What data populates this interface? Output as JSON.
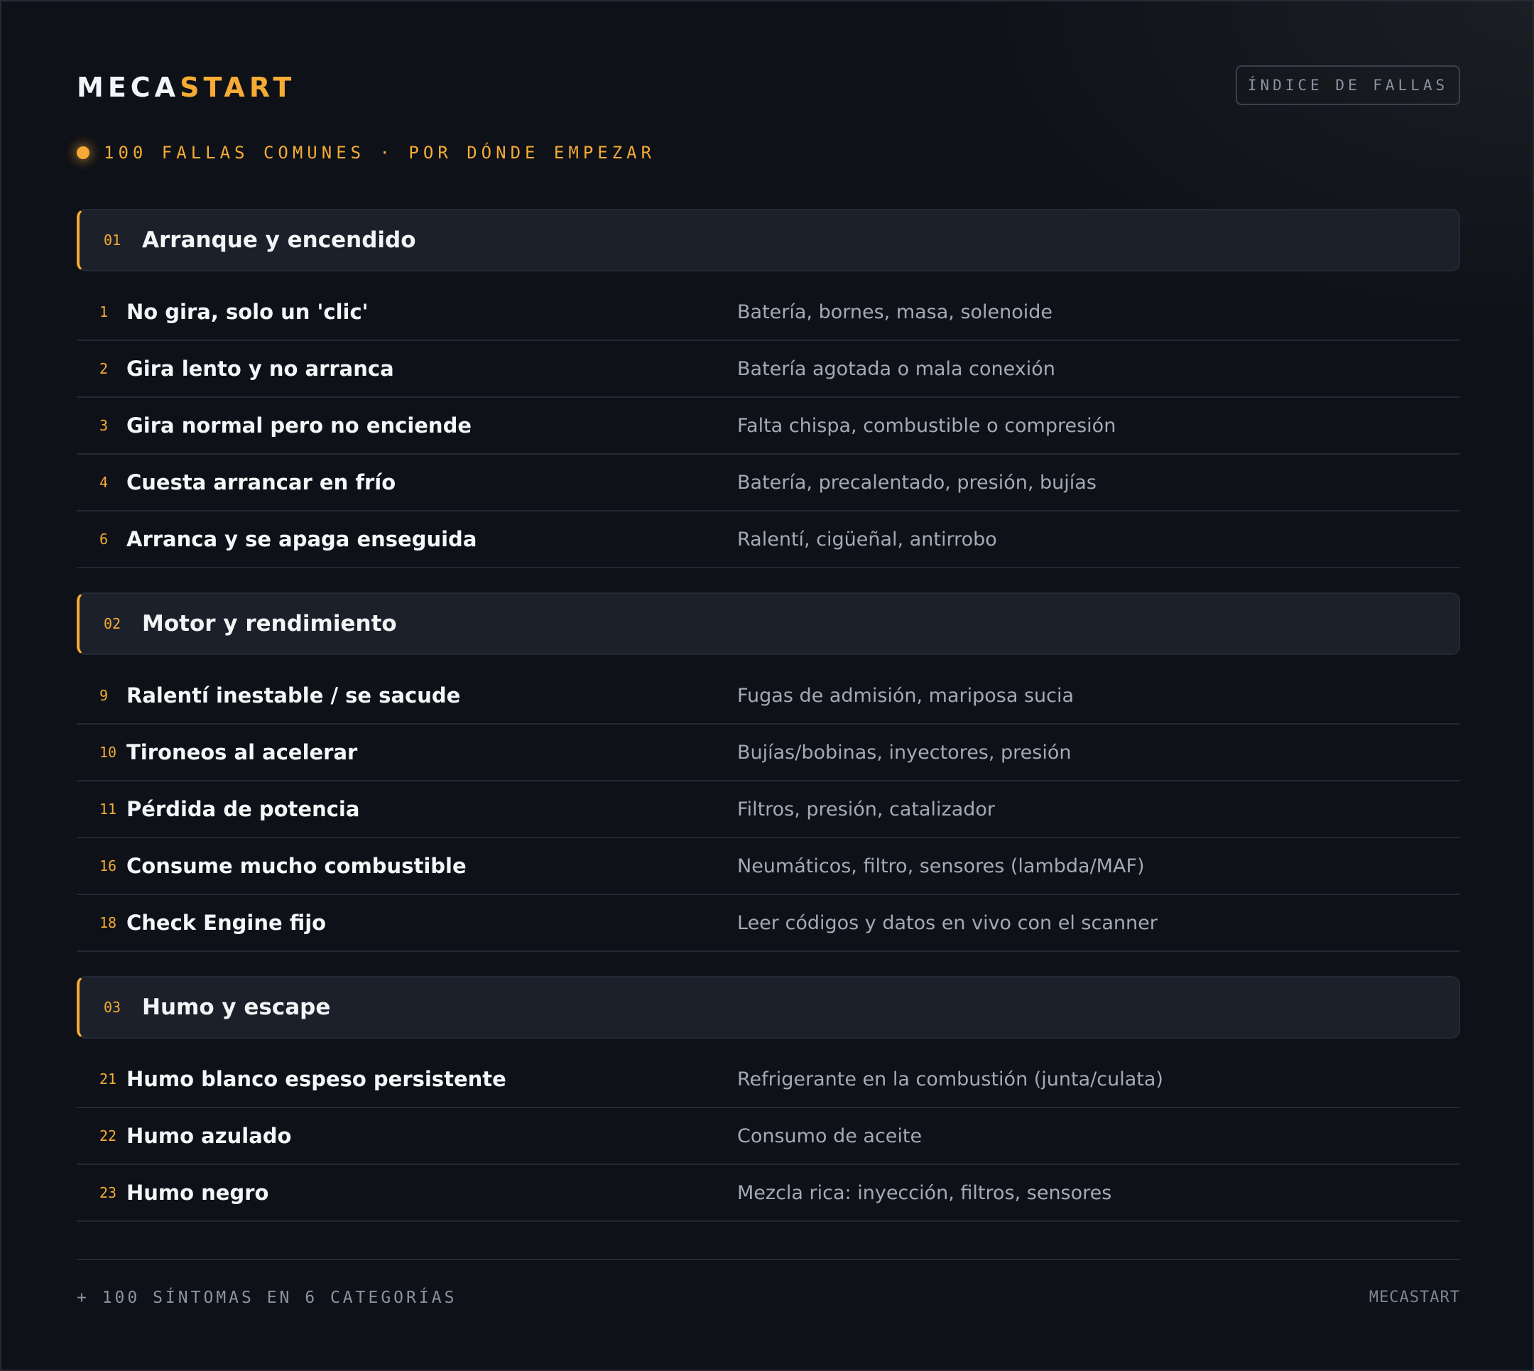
{
  "header": {
    "logo_part1": "MECA",
    "logo_part2": "START",
    "index_button": "ÍNDICE DE FALLAS"
  },
  "subtitle": "100 FALLAS COMUNES · POR DÓNDE EMPEZAR",
  "categories": [
    {
      "number": "01",
      "title": "Arranque y encendido",
      "items": [
        {
          "number": "1",
          "title": "No gira, solo un 'clic'",
          "desc": "Batería, bornes, masa, solenoide"
        },
        {
          "number": "2",
          "title": "Gira lento y no arranca",
          "desc": "Batería agotada o mala conexión"
        },
        {
          "number": "3",
          "title": "Gira normal pero no enciende",
          "desc": "Falta chispa, combustible o compresión"
        },
        {
          "number": "4",
          "title": "Cuesta arrancar en frío",
          "desc": "Batería, precalentado, presión, bujías"
        },
        {
          "number": "6",
          "title": "Arranca y se apaga enseguida",
          "desc": "Ralentí, cigüeñal, antirrobo"
        }
      ]
    },
    {
      "number": "02",
      "title": "Motor y rendimiento",
      "items": [
        {
          "number": "9",
          "title": "Ralentí inestable / se sacude",
          "desc": "Fugas de admisión, mariposa sucia"
        },
        {
          "number": "10",
          "title": "Tironeos al acelerar",
          "desc": "Bujías/bobinas, inyectores, presión"
        },
        {
          "number": "11",
          "title": "Pérdida de potencia",
          "desc": "Filtros, presión, catalizador"
        },
        {
          "number": "16",
          "title": "Consume mucho combustible",
          "desc": "Neumáticos, filtro, sensores (lambda/MAF)"
        },
        {
          "number": "18",
          "title": "Check Engine fijo",
          "desc": "Leer códigos y datos en vivo con el scanner"
        }
      ]
    },
    {
      "number": "03",
      "title": "Humo y escape",
      "items": [
        {
          "number": "21",
          "title": "Humo blanco espeso persistente",
          "desc": "Refrigerante en la combustión (junta/culata)"
        },
        {
          "number": "22",
          "title": "Humo azulado",
          "desc": "Consumo de aceite"
        },
        {
          "number": "23",
          "title": "Humo negro",
          "desc": "Mezcla rica: inyección, filtros, sensores"
        }
      ]
    }
  ],
  "footer": {
    "left": "+ 100 SÍNTOMAS EN 6 CATEGORÍAS",
    "right": "MECASTART"
  },
  "colors": {
    "background": "#0e1117",
    "accent": "#f5ab35",
    "text": "#f3f4f6",
    "muted": "#a3aab6"
  }
}
